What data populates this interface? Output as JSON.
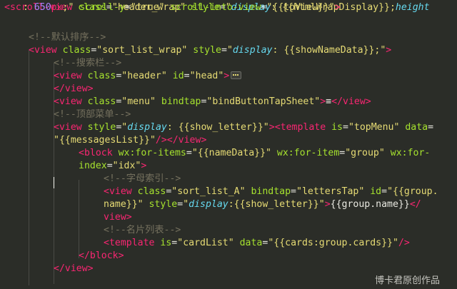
{
  "lines": [
    [
      [
        "tag",
        "<scroll-view "
      ],
      [
        "attr",
        "class"
      ],
      [
        "txt",
        "="
      ],
      [
        "str",
        "\"header_wrap\""
      ],
      [
        "txt",
        " "
      ],
      [
        "attr",
        "style"
      ],
      [
        "txt",
        "="
      ],
      [
        "str",
        "\""
      ],
      [
        "kw",
        "display"
      ],
      [
        "str",
        ": {{htmlWrapDisplay}};"
      ],
      [
        "kw",
        "height"
      ]
    ],
    [
      [
        "str",
        " : "
      ],
      [
        "num",
        "650"
      ],
      [
        "unit",
        "px"
      ],
      [
        "str",
        ";\""
      ],
      [
        "txt",
        " "
      ],
      [
        "attr",
        "scroll-y"
      ],
      [
        "txt",
        "="
      ],
      [
        "str",
        "\"true\""
      ],
      [
        "txt",
        " "
      ],
      [
        "attr",
        "scroll-into-view"
      ],
      [
        "txt",
        "="
      ],
      [
        "str",
        "\"{{toView}}\""
      ],
      [
        "tag",
        ">"
      ]
    ],
    [
      [
        "cmt",
        "<!--默认排序-->"
      ]
    ],
    [
      [
        "tag",
        "<view "
      ],
      [
        "attr",
        "class"
      ],
      [
        "txt",
        "="
      ],
      [
        "str",
        "\"sort_list_wrap\""
      ],
      [
        "txt",
        " "
      ],
      [
        "attr",
        "style"
      ],
      [
        "txt",
        "="
      ],
      [
        "str",
        "\""
      ],
      [
        "kw",
        "display"
      ],
      [
        "str",
        ": {{showNameData}};\""
      ],
      [
        "tag",
        ">"
      ]
    ],
    [
      [
        "cmt",
        "<!--搜索栏-->"
      ]
    ],
    [
      [
        "tag",
        "<view "
      ],
      [
        "attr",
        "class"
      ],
      [
        "txt",
        "="
      ],
      [
        "str",
        "\"header\""
      ],
      [
        "txt",
        " "
      ],
      [
        "attr",
        "id"
      ],
      [
        "txt",
        "="
      ],
      [
        "str",
        "\"head\""
      ],
      [
        "tag",
        ">"
      ]
    ],
    [
      [
        "tag",
        "</view>"
      ]
    ],
    [
      [
        "tag",
        "<view "
      ],
      [
        "attr",
        "class"
      ],
      [
        "txt",
        "="
      ],
      [
        "str",
        "\"menu\""
      ],
      [
        "txt",
        " "
      ],
      [
        "attr",
        "bindtap"
      ],
      [
        "txt",
        "="
      ],
      [
        "str",
        "\"bindButtonTapSheet\""
      ],
      [
        "tag",
        ">"
      ],
      [
        "txt",
        "≡"
      ],
      [
        "tag",
        "</view>"
      ]
    ],
    [
      [
        "cmt",
        "<!--顶部菜单-->"
      ]
    ],
    [
      [
        "tag",
        "<view "
      ],
      [
        "attr",
        "style"
      ],
      [
        "txt",
        "="
      ],
      [
        "str",
        "\""
      ],
      [
        "kw",
        "display"
      ],
      [
        "str",
        ": {{show_letter}}\""
      ],
      [
        "tag",
        "><template "
      ],
      [
        "attr",
        "is"
      ],
      [
        "txt",
        "="
      ],
      [
        "str",
        "\"topMenu\""
      ],
      [
        "txt",
        " "
      ],
      [
        "attr",
        "data"
      ],
      [
        "txt",
        "="
      ]
    ],
    [
      [
        "str",
        "\"{{messagesList}}\""
      ],
      [
        "tag",
        "/></view>"
      ]
    ],
    [
      [
        "tag",
        "<block "
      ],
      [
        "attr",
        "wx:for-items"
      ],
      [
        "txt",
        "="
      ],
      [
        "str",
        "\"{{nameData}}\""
      ],
      [
        "txt",
        " "
      ],
      [
        "attr",
        "wx:for-item"
      ],
      [
        "txt",
        "="
      ],
      [
        "str",
        "\"group\""
      ],
      [
        "txt",
        " "
      ],
      [
        "attr",
        "wx:for-"
      ]
    ],
    [
      [
        "attr",
        "index"
      ],
      [
        "txt",
        "="
      ],
      [
        "str",
        "\"idx\""
      ],
      [
        "tag",
        ">"
      ]
    ],
    [
      [
        "cmt",
        "<!--字母索引-->"
      ]
    ],
    [
      [
        "tag",
        "<view "
      ],
      [
        "attr",
        "class"
      ],
      [
        "txt",
        "="
      ],
      [
        "str",
        "\"sort_list_A\""
      ],
      [
        "txt",
        " "
      ],
      [
        "attr",
        "bindtap"
      ],
      [
        "txt",
        "="
      ],
      [
        "str",
        "\"lettersTap\""
      ],
      [
        "txt",
        " "
      ],
      [
        "attr",
        "id"
      ],
      [
        "txt",
        "="
      ],
      [
        "str",
        "\"{{group."
      ]
    ],
    [
      [
        "str",
        "name}}\""
      ],
      [
        "txt",
        " "
      ],
      [
        "attr",
        "style"
      ],
      [
        "txt",
        "="
      ],
      [
        "str",
        "\""
      ],
      [
        "kw",
        "display"
      ],
      [
        "str",
        ":{{show_letter}}\""
      ],
      [
        "tag",
        ">"
      ],
      [
        "txt",
        "{{group.name}}"
      ],
      [
        "tag",
        "</"
      ]
    ],
    [
      [
        "tag",
        "view>"
      ]
    ],
    [
      [
        "cmt",
        "<!--名片列表-->"
      ]
    ],
    [
      [
        "tag",
        "<template "
      ],
      [
        "attr",
        "is"
      ],
      [
        "txt",
        "="
      ],
      [
        "str",
        "\"cardList\""
      ],
      [
        "txt",
        " "
      ],
      [
        "attr",
        "data"
      ],
      [
        "txt",
        "="
      ],
      [
        "str",
        "\"{{cards:group.cards}}\""
      ],
      [
        "tag",
        "/>"
      ]
    ],
    [
      [
        "tag",
        "</block>"
      ]
    ],
    [
      [
        "tag",
        "</view>"
      ]
    ]
  ],
  "watermark": "博卡君原创作品"
}
